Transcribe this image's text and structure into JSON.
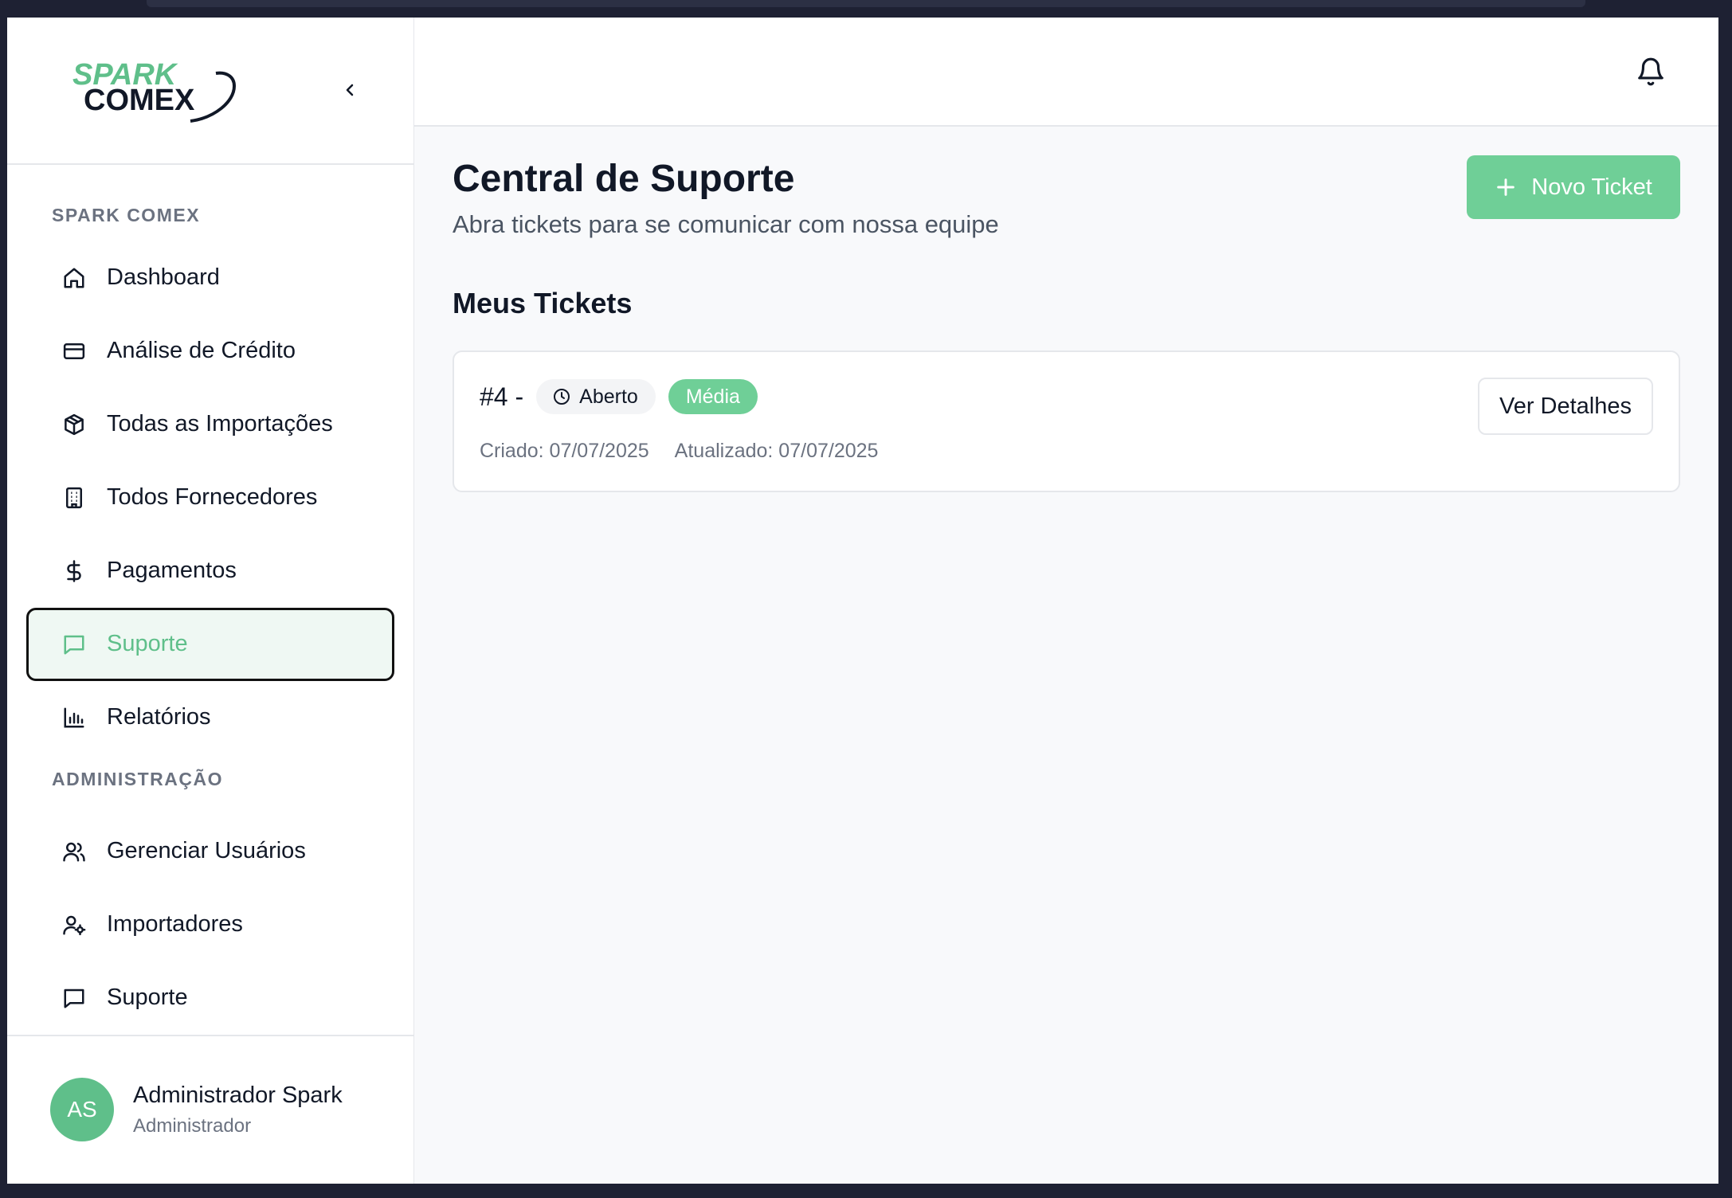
{
  "brand": {
    "logo_line1": "SPARK",
    "logo_line2": "COMEX",
    "accent_color": "#5fbf8a"
  },
  "sidebar": {
    "section_main": "SPARK COMEX",
    "items": [
      {
        "label": "Dashboard",
        "icon": "home-icon"
      },
      {
        "label": "Análise de Crédito",
        "icon": "credit-card-icon"
      },
      {
        "label": "Todas as Importações",
        "icon": "package-icon"
      },
      {
        "label": "Todos Fornecedores",
        "icon": "building-icon"
      },
      {
        "label": "Pagamentos",
        "icon": "dollar-icon"
      },
      {
        "label": "Suporte",
        "icon": "message-square-icon",
        "active": true
      },
      {
        "label": "Relatórios",
        "icon": "bar-chart-icon"
      }
    ],
    "section_admin": "ADMINISTRAÇÃO",
    "admin_items": [
      {
        "label": "Gerenciar Usuários",
        "icon": "users-icon"
      },
      {
        "label": "Importadores",
        "icon": "user-cog-icon"
      },
      {
        "label": "Suporte",
        "icon": "message-square-icon"
      }
    ],
    "user": {
      "initials": "AS",
      "name": "Administrador Spark",
      "role": "Administrador"
    }
  },
  "main": {
    "title": "Central de Suporte",
    "subtitle": "Abra tickets para se comunicar com nossa equipe",
    "new_ticket_label": "Novo Ticket",
    "section_title": "Meus Tickets",
    "tickets": [
      {
        "id": "#4 -",
        "status": "Aberto",
        "priority": "Média",
        "created": "Criado: 07/07/2025",
        "updated": "Atualizado: 07/07/2025",
        "details_label": "Ver Detalhes"
      }
    ]
  }
}
